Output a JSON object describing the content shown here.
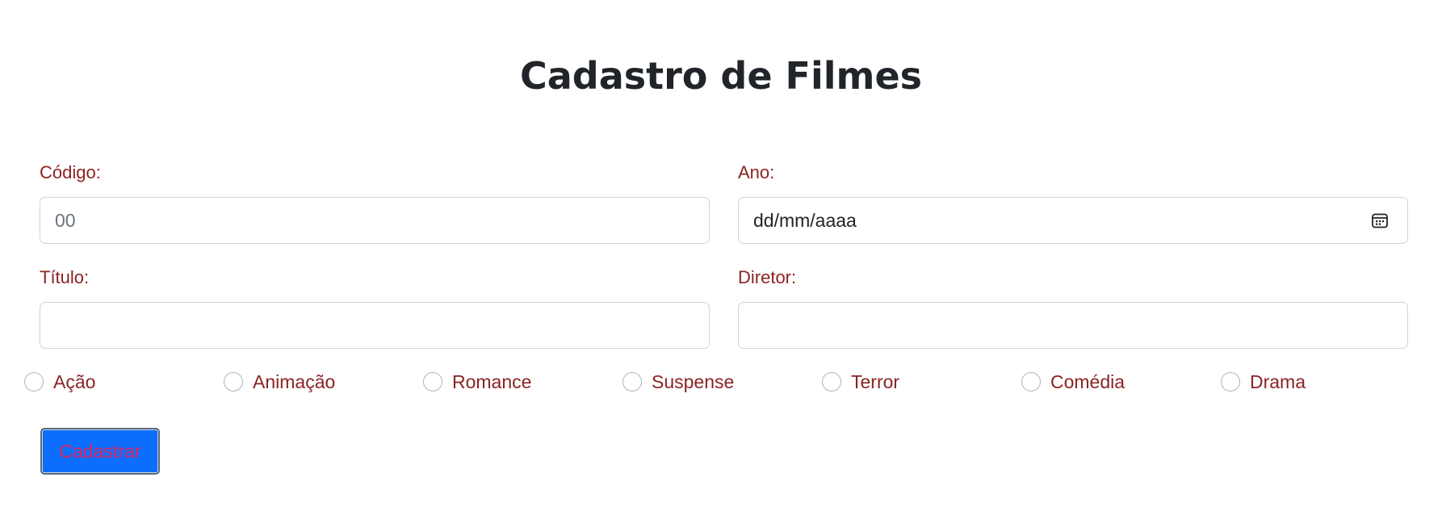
{
  "page": {
    "title": "Cadastro de Filmes"
  },
  "form": {
    "codigo": {
      "label": "Código:",
      "placeholder": "00",
      "value": ""
    },
    "ano": {
      "label": "Ano:",
      "value": "dd/mm/aaaa",
      "icon": "calendar-icon"
    },
    "titulo": {
      "label": "Título:",
      "value": ""
    },
    "diretor": {
      "label": "Diretor:",
      "value": ""
    },
    "genres": [
      {
        "label": "Ação",
        "checked": false
      },
      {
        "label": "Animação",
        "checked": false
      },
      {
        "label": "Romance",
        "checked": false
      },
      {
        "label": "Suspense",
        "checked": false
      },
      {
        "label": "Terror",
        "checked": false
      },
      {
        "label": "Comédia",
        "checked": false
      },
      {
        "label": "Drama",
        "checked": false
      }
    ],
    "submit_label": "Cadastrar"
  },
  "colors": {
    "label": "#8b2323",
    "button_bg": "#0d6efd",
    "button_text": "#e0245e",
    "input_border": "#ced4da"
  }
}
